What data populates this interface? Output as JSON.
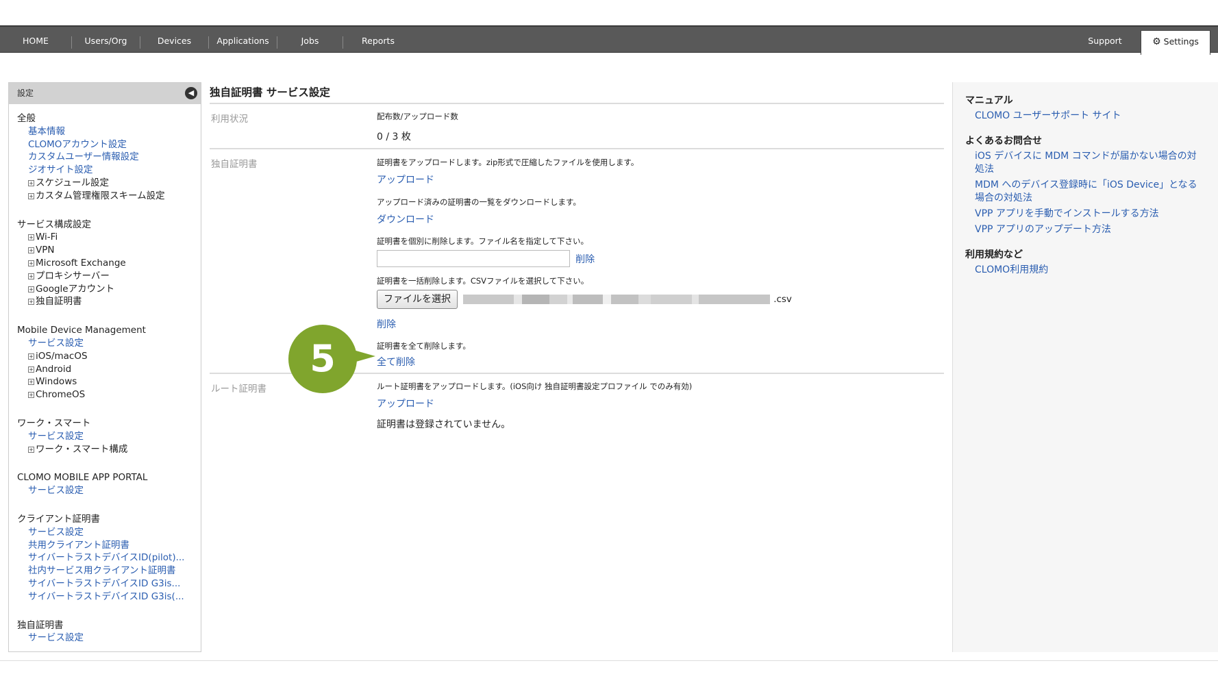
{
  "nav": {
    "items": [
      "HOME",
      "Users/Org",
      "Devices",
      "Applications",
      "Jobs",
      "Reports"
    ],
    "support": "Support",
    "settings": "Settings"
  },
  "sidebar": {
    "header": "設定",
    "sections": {
      "general": {
        "title": "全般",
        "links": [
          "基本情報",
          "CLOMOアカウント設定",
          "カスタムユーザー情報設定",
          "ジオサイト設定"
        ],
        "expandables": [
          "スケジュール設定",
          "カスタム管理権限スキーム設定"
        ]
      },
      "service_config": {
        "title": "サービス構成設定",
        "expandables": [
          "Wi-Fi",
          "VPN",
          "Microsoft Exchange",
          "プロキシサーバー",
          "Googleアカウント",
          "独自証明書"
        ]
      },
      "mdm": {
        "title": "Mobile Device Management",
        "links": [
          "サービス設定"
        ],
        "expandables": [
          "iOS/macOS",
          "Android",
          "Windows",
          "ChromeOS"
        ]
      },
      "work_smart": {
        "title": "ワーク・スマート",
        "links": [
          "サービス設定"
        ],
        "expandables": [
          "ワーク・スマート構成"
        ]
      },
      "app_portal": {
        "title": "CLOMO MOBILE APP PORTAL",
        "links": [
          "サービス設定"
        ]
      },
      "client_cert": {
        "title": "クライアント証明書",
        "links": [
          "サービス設定",
          "共用クライアント証明書",
          "サイバートラストデバイスID(pilot)...",
          "社内サービス用クライアント証明書",
          "サイバートラストデバイスID G3is...",
          "サイバートラストデバイスID G3is(..."
        ]
      },
      "own_cert": {
        "title": "独自証明書",
        "links": [
          "サービス設定"
        ]
      }
    }
  },
  "main": {
    "title": "独自証明書 サービス設定",
    "usage": {
      "label": "利用状況",
      "caption": "配布数/アップロード数",
      "value": "0 / 3 枚"
    },
    "own_cert": {
      "label": "独自証明書",
      "upload_desc": "証明書をアップロードします。zip形式で圧縮したファイルを使用します。",
      "upload_link": "アップロード",
      "download_desc": "アップロード済みの証明書の一覧をダウンロードします。",
      "download_link": "ダウンロード",
      "delete_desc": "証明書を個別に削除します。ファイル名を指定して下さい。",
      "delete_link": "削除",
      "delete_value": "",
      "bulk_desc": "証明書を一括削除します。CSVファイルを選択して下さい。",
      "file_button": "ファイルを選択",
      "file_ext": ".csv",
      "bulk_delete_link": "削除",
      "all_desc": "証明書を全て削除します。",
      "all_delete_link": "全て削除"
    },
    "root_cert": {
      "label": "ルート証明書",
      "desc": "ルート証明書をアップロードします。(iOS向け 独自証明書設定プロファイル でのみ有効)",
      "upload_link": "アップロード",
      "status": "証明書は登録されていません。"
    }
  },
  "callout": {
    "number": "5",
    "color": "#80a52d"
  },
  "right_panel": {
    "manual": {
      "title": "マニュアル",
      "links": [
        "CLOMO ユーザーサポート サイト"
      ]
    },
    "faq": {
      "title": "よくあるお問合せ",
      "links": [
        "iOS デバイスに MDM コマンドが届かない場合の対処法",
        "MDM へのデバイス登録時に「iOS Device」となる場合の対処法",
        "VPP アプリを手動でインストールする方法",
        "VPP アプリのアップデート方法"
      ]
    },
    "terms": {
      "title": "利用規約など",
      "links": [
        "CLOMO利用規約"
      ]
    }
  },
  "colors": {
    "link": "#2a5db0",
    "nav_bg": "#595959",
    "accent": "#80a52d"
  }
}
